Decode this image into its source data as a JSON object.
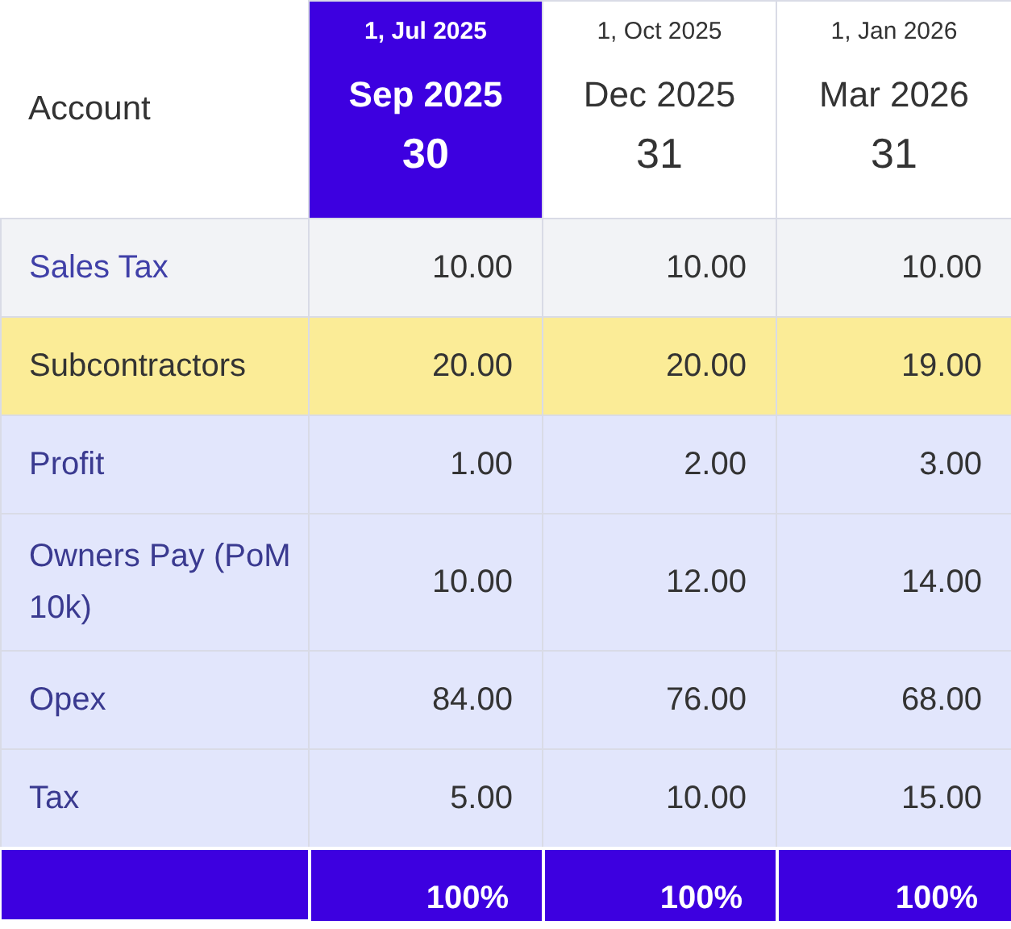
{
  "table": {
    "account_heading": "Account",
    "columns": [
      {
        "start": "1, Jul 2025",
        "month": "Sep 2025",
        "days": "30",
        "selected": true
      },
      {
        "start": "1, Oct 2025",
        "month": "Dec 2025",
        "days": "31",
        "selected": false
      },
      {
        "start": "1, Jan 2026",
        "month": "Mar 2026",
        "days": "31",
        "selected": false
      }
    ],
    "rows": [
      {
        "account": "Sales Tax",
        "kind": "plain",
        "values": [
          "10.00",
          "10.00",
          "10.00"
        ]
      },
      {
        "account": "Subcontractors",
        "kind": "highlight",
        "values": [
          "20.00",
          "20.00",
          "19.00"
        ]
      },
      {
        "account": "Profit",
        "kind": "group",
        "values": [
          "1.00",
          "2.00",
          "3.00"
        ]
      },
      {
        "account": "Owners Pay (PoM 10k)",
        "kind": "group",
        "values": [
          "10.00",
          "12.00",
          "14.00"
        ]
      },
      {
        "account": "Opex",
        "kind": "group",
        "values": [
          "84.00",
          "76.00",
          "68.00"
        ]
      },
      {
        "account": "Tax",
        "kind": "group",
        "values": [
          "5.00",
          "10.00",
          "15.00"
        ]
      }
    ],
    "totals": [
      "100%",
      "100%",
      "100%"
    ]
  }
}
